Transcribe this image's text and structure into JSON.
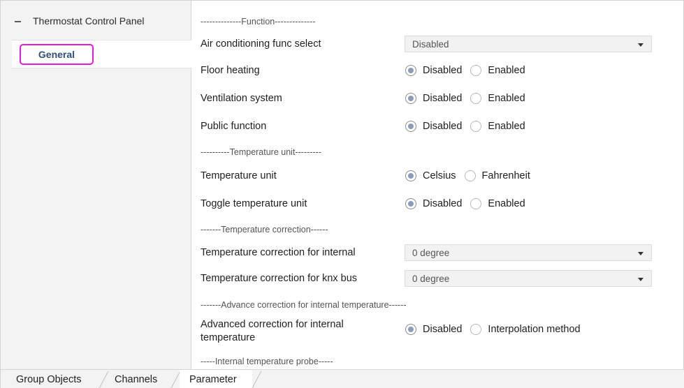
{
  "sidebar": {
    "root_label": "Thermostat Control Panel",
    "selected_item": "General"
  },
  "main": {
    "function_header": "--------------Function--------------",
    "air_conditioning": {
      "label": "Air conditioning func select",
      "value": "Disabled"
    },
    "floor_heating": {
      "label": "Floor heating",
      "options": [
        "Disabled",
        "Enabled"
      ],
      "selected": "Disabled"
    },
    "ventilation": {
      "label": "Ventilation system",
      "options": [
        "Disabled",
        "Enabled"
      ],
      "selected": "Disabled"
    },
    "public_function": {
      "label": "Public function",
      "options": [
        "Disabled",
        "Enabled"
      ],
      "selected": "Disabled"
    },
    "temp_unit_header": "----------Temperature unit---------",
    "temperature_unit": {
      "label": "Temperature unit",
      "options": [
        "Celsius",
        "Fahrenheit"
      ],
      "selected": "Celsius"
    },
    "toggle_unit": {
      "label": "Toggle temperature unit",
      "options": [
        "Disabled",
        "Enabled"
      ],
      "selected": "Disabled"
    },
    "temp_correction_header": "-------Temperature correction------",
    "correction_internal": {
      "label": "Temperature correction for internal",
      "value": "0 degree"
    },
    "correction_knx": {
      "label": "Temperature correction for knx bus",
      "value": "0 degree"
    },
    "advance_header": "-------Advance correction for internal temperature------",
    "advanced_correction": {
      "label_line1": "Advanced correction for internal",
      "label_line2": "temperature",
      "options": [
        "Disabled",
        "Interpolation method"
      ],
      "selected": "Disabled"
    },
    "probe_header": "-----Internal temperature probe-----"
  },
  "tabs": [
    {
      "label": "Group Objects"
    },
    {
      "label": "Channels"
    },
    {
      "label": "Parameter",
      "active": true
    }
  ]
}
